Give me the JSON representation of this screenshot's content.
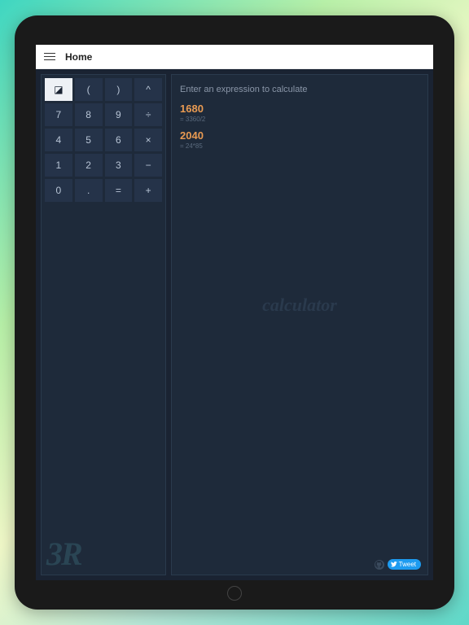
{
  "topbar": {
    "title": "Home"
  },
  "keypad": {
    "rows": [
      [
        {
          "label": "◪",
          "name": "clear-icon",
          "special": true
        },
        {
          "label": "(",
          "name": "paren-open-key"
        },
        {
          "label": ")",
          "name": "paren-close-key"
        },
        {
          "label": "^",
          "name": "power-key"
        }
      ],
      [
        {
          "label": "7",
          "name": "key-7"
        },
        {
          "label": "8",
          "name": "key-8"
        },
        {
          "label": "9",
          "name": "key-9"
        },
        {
          "label": "÷",
          "name": "divide-key"
        }
      ],
      [
        {
          "label": "4",
          "name": "key-4"
        },
        {
          "label": "5",
          "name": "key-5"
        },
        {
          "label": "6",
          "name": "key-6"
        },
        {
          "label": "×",
          "name": "multiply-key"
        }
      ],
      [
        {
          "label": "1",
          "name": "key-1"
        },
        {
          "label": "2",
          "name": "key-2"
        },
        {
          "label": "3",
          "name": "key-3"
        },
        {
          "label": "−",
          "name": "minus-key"
        }
      ],
      [
        {
          "label": "0",
          "name": "key-0"
        },
        {
          "label": ".",
          "name": "decimal-key"
        },
        {
          "label": "=",
          "name": "equals-key"
        },
        {
          "label": "+",
          "name": "plus-key"
        }
      ]
    ]
  },
  "brand": "3R",
  "input": {
    "placeholder": "Enter an expression to calculate"
  },
  "history": [
    {
      "value": "1680",
      "expr": "= 3360/2"
    },
    {
      "value": "2040",
      "expr": "= 24*85"
    }
  ],
  "watermark": "calculator",
  "footer": {
    "tweet_label": "Tweet"
  }
}
